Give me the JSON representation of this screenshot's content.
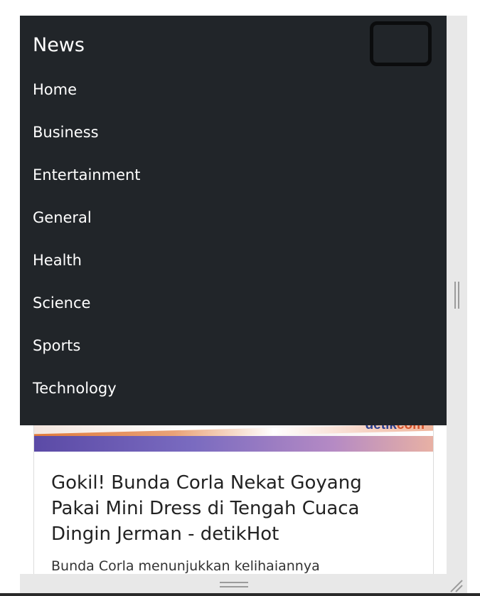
{
  "navbar": {
    "brand": "News",
    "items": [
      {
        "label": "Home"
      },
      {
        "label": "Business"
      },
      {
        "label": "Entertainment"
      },
      {
        "label": "General"
      },
      {
        "label": "Health"
      },
      {
        "label": "Science"
      },
      {
        "label": "Sports"
      },
      {
        "label": "Technology"
      }
    ]
  },
  "card": {
    "image_brand_part1": "detik",
    "image_brand_part2": "com",
    "title": "Gokil! Bunda Corla Nekat Goyang Pakai Mini Dress di Tengah Cuaca Dingin Jerman - detikHot",
    "description": "Bunda Corla menunjukkan kelihaiannya"
  },
  "colors": {
    "navbar_bg": "#212529",
    "nav_text": "#ffffff"
  }
}
